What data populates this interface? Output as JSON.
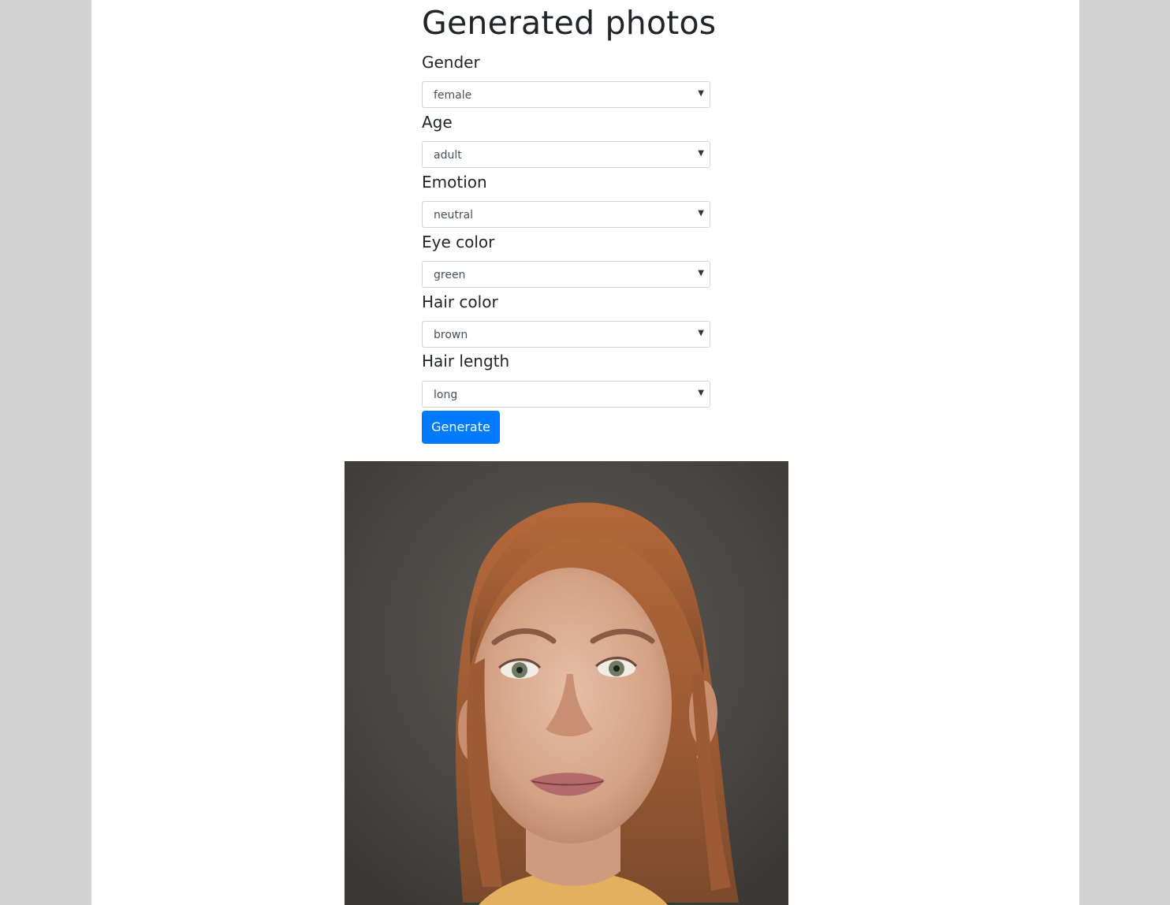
{
  "page": {
    "title": "Generated photos"
  },
  "form": {
    "fields": [
      {
        "label": "Gender",
        "value": "female"
      },
      {
        "label": "Age",
        "value": "adult"
      },
      {
        "label": "Emotion",
        "value": "neutral"
      },
      {
        "label": "Eye color",
        "value": "green"
      },
      {
        "label": "Hair color",
        "value": "brown"
      },
      {
        "label": "Hair length",
        "value": "long"
      }
    ],
    "submit_label": "Generate"
  },
  "icons": {
    "select_caret": "caret-down-icon"
  },
  "colors": {
    "background": "#d3d3d3",
    "primary_button": "#007bff"
  }
}
